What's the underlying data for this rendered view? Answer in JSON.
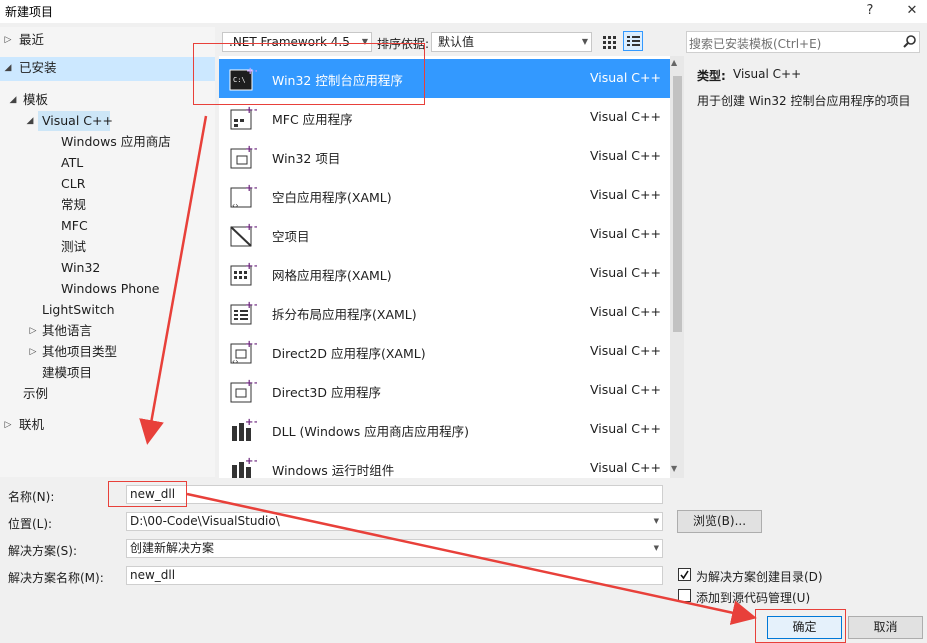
{
  "window": {
    "title": "新建项目",
    "help_btn": "?",
    "close_btn": "✕"
  },
  "tree": {
    "recent": "最近",
    "installed": "已安装",
    "templates": "模板",
    "visual_cpp": "Visual C++",
    "vc_children": [
      "Windows 应用商店",
      "ATL",
      "CLR",
      "常规",
      "MFC",
      "测试",
      "Win32",
      "Windows Phone"
    ],
    "lightswitch": "LightSwitch",
    "other_langs": "其他语言",
    "other_types": "其他项目类型",
    "modeling": "建模项目",
    "samples": "示例",
    "online": "联机"
  },
  "toolbar": {
    "framework": ".NET Framework 4.5",
    "sort_label": "排序依据:",
    "sort_value": "默认值"
  },
  "search": {
    "placeholder": "搜索已安装模板(Ctrl+E)"
  },
  "templates": [
    {
      "name": "Win32 控制台应用程序",
      "lang": "Visual C++",
      "icon": "console-app-icon",
      "selected": true
    },
    {
      "name": "MFC 应用程序",
      "lang": "Visual C++",
      "icon": "mfc-app-icon"
    },
    {
      "name": "Win32 项目",
      "lang": "Visual C++",
      "icon": "win32-project-icon"
    },
    {
      "name": "空白应用程序(XAML)",
      "lang": "Visual C++",
      "icon": "blank-xaml-app-icon"
    },
    {
      "name": "空项目",
      "lang": "Visual C++",
      "icon": "empty-project-icon"
    },
    {
      "name": "网格应用程序(XAML)",
      "lang": "Visual C++",
      "icon": "grid-xaml-app-icon"
    },
    {
      "name": "拆分布局应用程序(XAML)",
      "lang": "Visual C++",
      "icon": "split-xaml-app-icon"
    },
    {
      "name": "Direct2D 应用程序(XAML)",
      "lang": "Visual C++",
      "icon": "direct2d-app-icon"
    },
    {
      "name": "Direct3D 应用程序",
      "lang": "Visual C++",
      "icon": "direct3d-app-icon"
    },
    {
      "name": "DLL (Windows 应用商店应用程序)",
      "lang": "Visual C++",
      "icon": "dll-icon"
    },
    {
      "name": "Windows 运行时组件",
      "lang": "Visual C++",
      "icon": "runtime-component-icon"
    }
  ],
  "details": {
    "type_label": "类型:",
    "type_value": "Visual C++",
    "description": "用于创建 Win32 控制台应用程序的项目"
  },
  "form": {
    "name_label": "名称(N):",
    "name_value": "new_dll",
    "location_label": "位置(L):",
    "location_value": "D:\\00-Code\\VisualStudio\\",
    "browse_btn": "浏览(B)...",
    "solution_label": "解决方案(S):",
    "solution_value": "创建新解决方案",
    "solution_name_label": "解决方案名称(M):",
    "solution_name_value": "new_dll",
    "create_dir_label": "为解决方案创建目录(D)",
    "create_dir_checked": true,
    "source_control_label": "添加到源代码管理(U)",
    "source_control_checked": false,
    "ok_btn": "确定",
    "cancel_btn": "取消"
  },
  "colors": {
    "selection": "#3399ff",
    "annotation": "#e8403a",
    "tree_selected": "#cce8ff"
  }
}
